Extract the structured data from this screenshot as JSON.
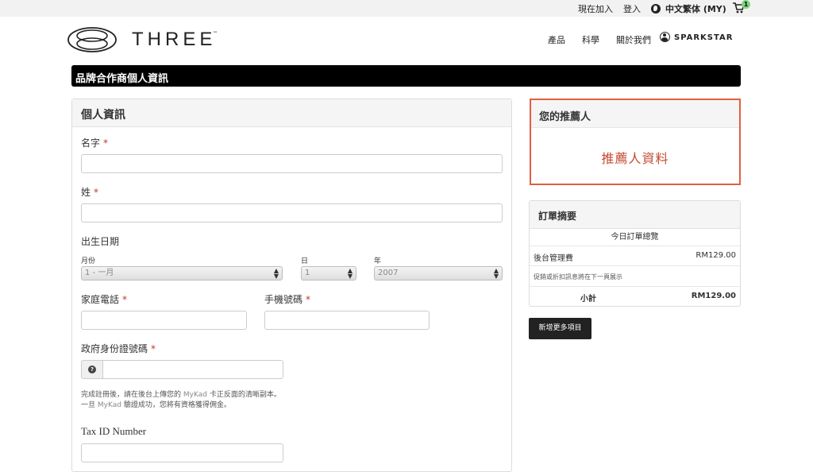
{
  "topbar": {
    "join_now": "現在加入",
    "login": "登入",
    "language": "中文繁体 (MY)",
    "cart_count": "1"
  },
  "brand": {
    "name": "THREE",
    "tm": "™"
  },
  "nav": {
    "products": "產品",
    "science": "科學",
    "about": "關於我們",
    "user": "SPARKSTAR"
  },
  "page_title": "品牌合作商個人資訊",
  "personal": {
    "heading": "個人資訊",
    "first_name_label": "名字",
    "last_name_label": "姓",
    "required_mark": "*",
    "dob_label": "出生日期",
    "month_label": "月份",
    "day_label": "日",
    "year_label": "年",
    "month_value": "1 - 一月",
    "day_value": "1",
    "year_value": "2007",
    "home_phone_label": "家庭電話",
    "mobile_label": "手機號碼",
    "gov_id_label": "政府身份證號碼",
    "help_line1_a": "完成註冊後，請在後台上傳您的 ",
    "help_line1_mk": "MyKad",
    "help_line1_b": " 卡正反面的清晰副本。",
    "help_line2_a": "一旦 ",
    "help_line2_mk": "MyKad",
    "help_line2_b": " 驗證成功，您將有資格獲得佣金。",
    "tax_label": "Tax ID Number"
  },
  "sponsor": {
    "heading": "您的推薦人",
    "info": "推薦人資料"
  },
  "order": {
    "heading": "訂單摘要",
    "today_total": "今日訂單總覽",
    "backoffice_fee_label": "後台管理費",
    "backoffice_fee_value": "RM129.00",
    "promo_note": "促銷或折扣訊息將在下一頁展示",
    "subtotal_label": "小計",
    "subtotal_value": "RM129.00"
  },
  "add_more_button": "新增更多項目"
}
